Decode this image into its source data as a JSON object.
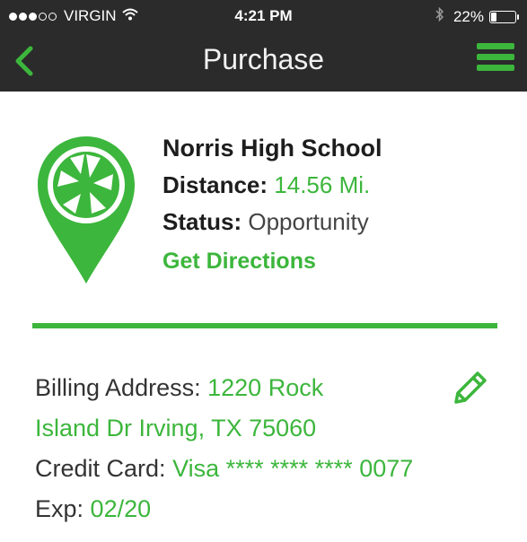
{
  "status_bar": {
    "carrier": "VIRGIN",
    "time": "4:21 PM",
    "battery": "22%",
    "battery_level": 0.22,
    "signal_bars_filled": 3,
    "signal_bars_total": 5
  },
  "nav": {
    "title": "Purchase",
    "back_icon": "chevron-left-icon",
    "menu_icon": "hamburger-menu-icon"
  },
  "location": {
    "name": "Norris High School",
    "distance_label": "Distance:",
    "distance_value": "14.56 Mi.",
    "status_label": "Status:",
    "status_value": "Opportunity",
    "directions_link": "Get Directions",
    "pin_icon": "map-pin-aperture-icon"
  },
  "billing": {
    "address_label": "Billing Address:",
    "address_line1": "1220 Rock",
    "address_line2": "Island Dr Irving, TX 75060",
    "card_label": "Credit Card:",
    "card_value": "Visa **** **** **** 0077",
    "exp_label": "Exp:",
    "exp_value": "02/20",
    "edit_icon": "pencil-edit-icon"
  },
  "colors": {
    "accent": "#3cb63c",
    "header_bg": "#2b2b2b",
    "text": "#333333"
  }
}
